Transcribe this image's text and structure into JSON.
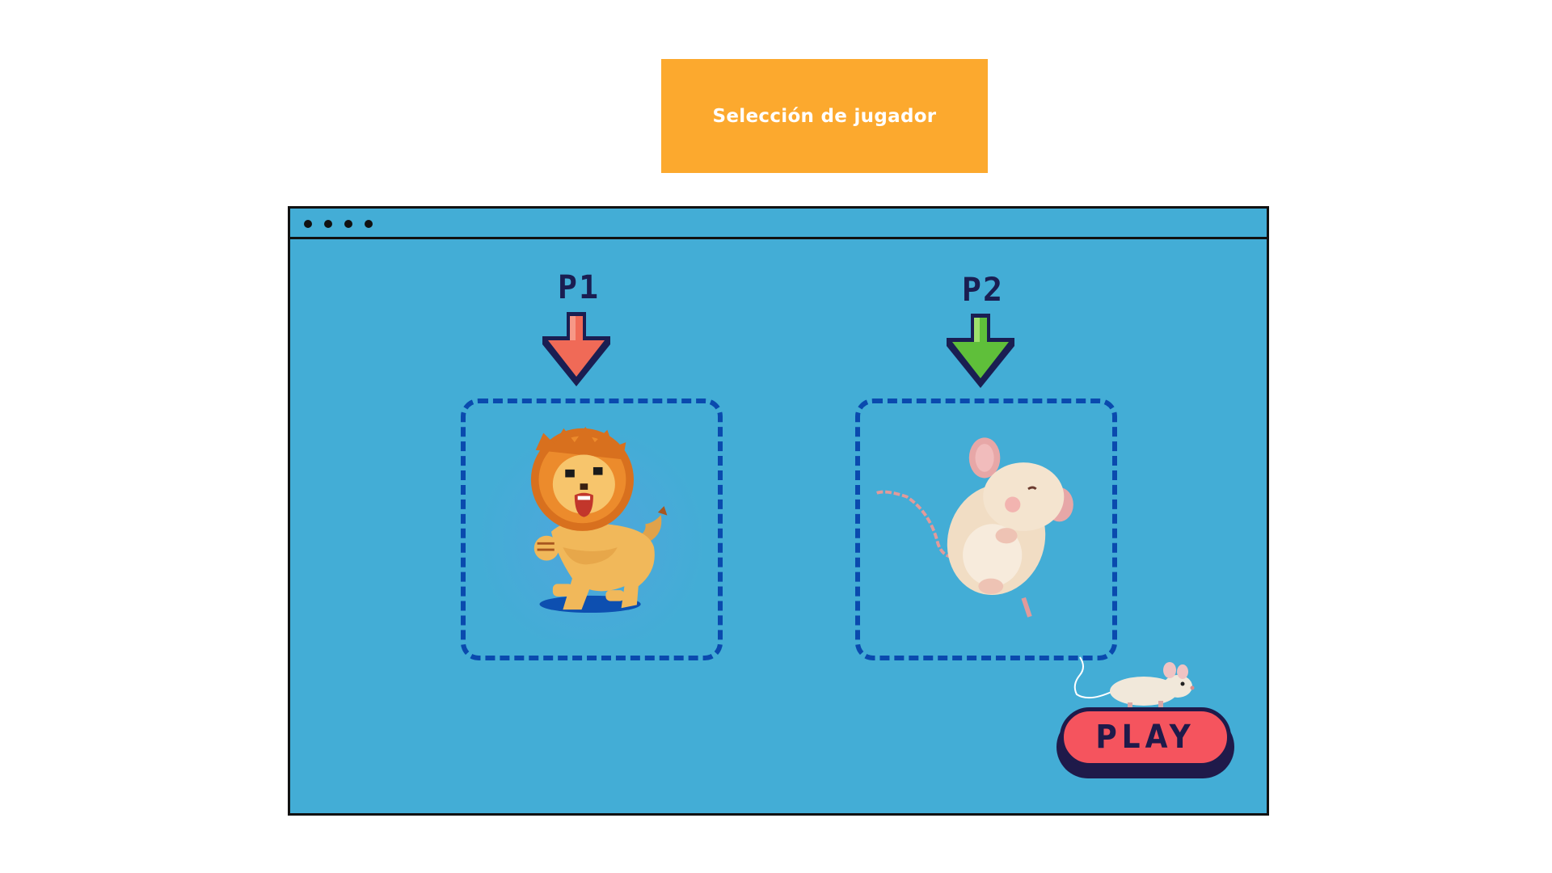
{
  "header": {
    "title": "Selección de jugador",
    "banner_color": "#fca92e"
  },
  "window": {
    "background": "#43add6",
    "titlebar_dots": 4
  },
  "players": [
    {
      "label": "P1",
      "arrow_color": "#f06a57",
      "character": "lion"
    },
    {
      "label": "P2",
      "arrow_color": "#5fbf3a",
      "character": "mouse"
    }
  ],
  "play_button": {
    "label": "PLAY",
    "color": "#f5545e",
    "text_color": "#1f1a4a"
  },
  "colors": {
    "slot_border": "#0a4aae",
    "outline": "#111111"
  }
}
